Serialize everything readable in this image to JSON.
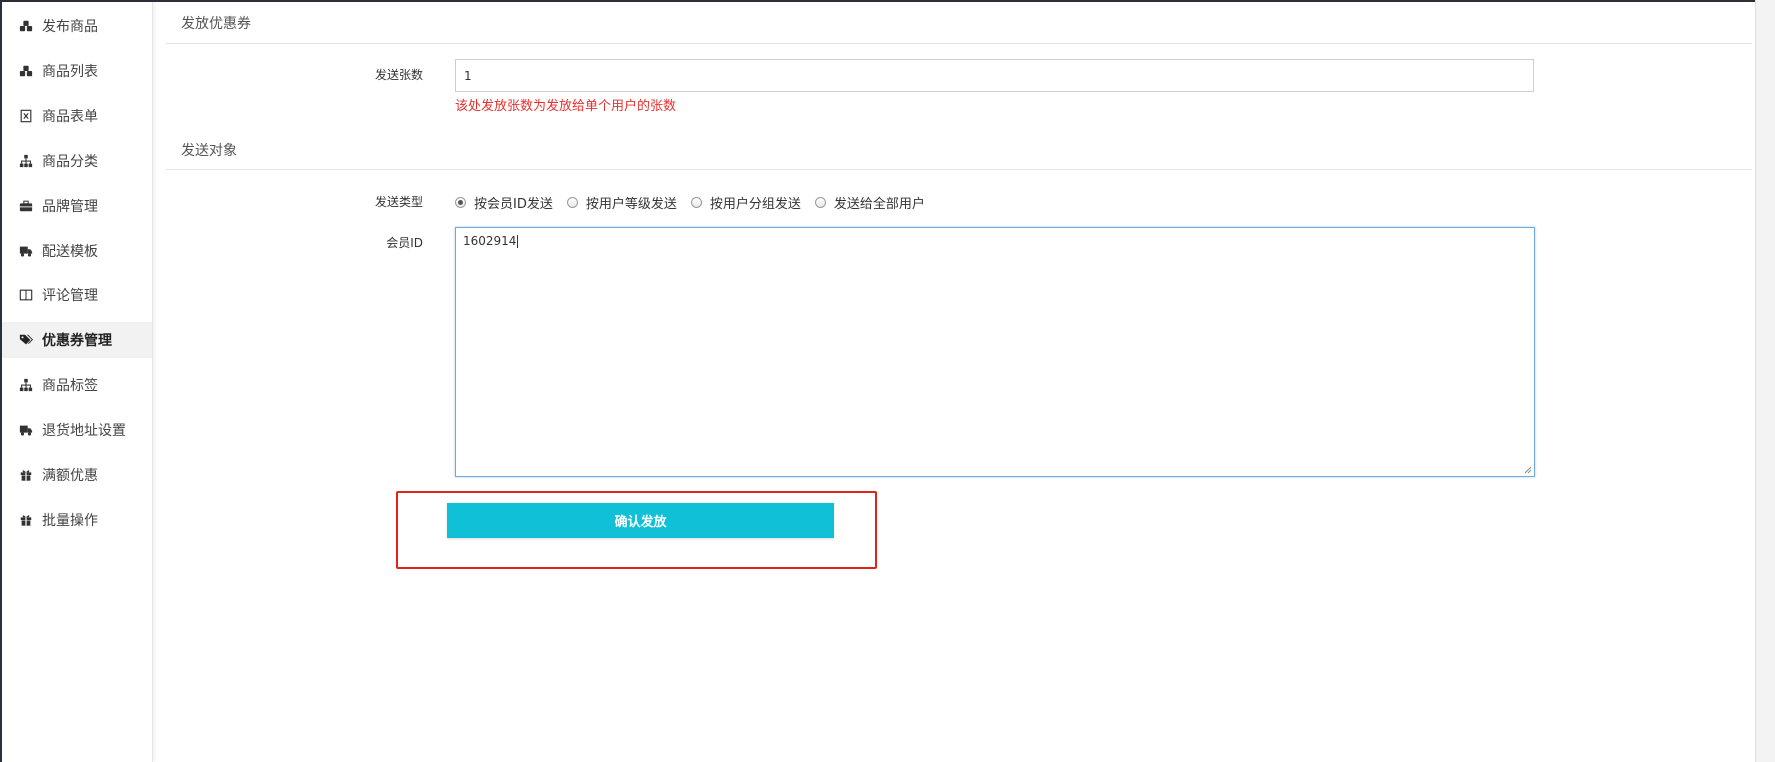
{
  "sidebar": {
    "items": [
      {
        "label": "发布商品",
        "icon": "cubes-icon"
      },
      {
        "label": "商品列表",
        "icon": "cubes-icon"
      },
      {
        "label": "商品表单",
        "icon": "excel-file-icon"
      },
      {
        "label": "商品分类",
        "icon": "sitemap-icon"
      },
      {
        "label": "品牌管理",
        "icon": "briefcase-icon"
      },
      {
        "label": "配送模板",
        "icon": "truck-icon"
      },
      {
        "label": "评论管理",
        "icon": "columns-icon"
      },
      {
        "label": "优惠券管理",
        "icon": "tags-icon",
        "active": true
      },
      {
        "label": "商品标签",
        "icon": "sitemap-icon"
      },
      {
        "label": "退货地址设置",
        "icon": "truck-icon"
      },
      {
        "label": "满额优惠",
        "icon": "gift-icon"
      },
      {
        "label": "批量操作",
        "icon": "gift-icon"
      }
    ]
  },
  "coupon_section": {
    "title": "发放优惠券",
    "quantity_label": "发送张数",
    "quantity_value": "1",
    "quantity_hint": "该处发放张数为发放给单个用户的张数"
  },
  "target_section": {
    "title": "发送对象",
    "type_label": "发送类型",
    "type_options": [
      {
        "label": "按会员ID发送",
        "checked": true
      },
      {
        "label": "按用户等级发送",
        "checked": false
      },
      {
        "label": "按用户分组发送",
        "checked": false
      },
      {
        "label": "发送给全部用户",
        "checked": false
      }
    ],
    "member_id_label": "会员ID",
    "member_id_value": "1602914"
  },
  "submit": {
    "label": "确认发放"
  },
  "colors": {
    "accent": "#0fc0d6",
    "hint_red": "#e8312f",
    "highlight_red": "#e2231a",
    "focus_blue": "#6fa9e0"
  }
}
